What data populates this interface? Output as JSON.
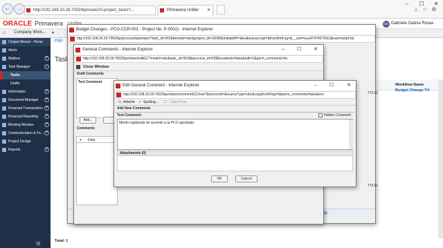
{
  "browser": {
    "url": "http://192.168.20.26:7002/bp/route/2/i-project_tasks?...",
    "tab_title": "Primavera Unifier"
  },
  "oracle": {
    "brand": "ORACLE",
    "product": "Primavera",
    "product_suffix": "Unifier",
    "workspace": "Company Work...",
    "user_initials": "GG",
    "user_name": "Gabriela Galicia Rosas"
  },
  "sidebar": {
    "items": [
      {
        "label": "Chapel-Resort - Home"
      },
      {
        "label": "Alerts"
      },
      {
        "label": "Mailbox"
      },
      {
        "label": "Task Manager"
      },
      {
        "label": "Tasks"
      },
      {
        "label": "Drafts"
      },
      {
        "label": "Information"
      },
      {
        "label": "Document Manager"
      },
      {
        "label": "Financial Transactions"
      },
      {
        "label": "Financial Reporting"
      },
      {
        "label": "Meeting Minutes"
      },
      {
        "label": "Communication & Fo..."
      },
      {
        "label": "Project Design"
      },
      {
        "label": "Reports"
      }
    ]
  },
  "main": {
    "title_partial": "Task",
    "psp": "PSP",
    "workflow_name_header": "Workflow Name",
    "workflow_value": "Budget Change TU",
    "total": "Total: 1",
    "amount1": "773.61",
    "amount2": "773.61",
    "mail_link": "ted Mail (0)"
  },
  "dialog_budget": {
    "title": "Budget Changes - PCO-CCR-001 - Project No. P-0002) - Internet Explorer",
    "url": "http://192.168.20.26:7002/bp/process/task/open?task_id=3018&model=ubc&project_id=10098&initiateBP=&bulkautoaccept=&fromRefLog=&__uref=uuu474745709c3&raw=inelpt:fal"
  },
  "dialog_general": {
    "title": "General Comments - Internet Explorer",
    "url": "http://192.168.20.26:7002/bp/share/editGC?model=ubc&task_id=3018&process_id=528&readonly=false&edit=1&perm_comments=fa",
    "close_window": "Close Window",
    "draft_comments": "Draft Comments",
    "text_comment": "Text Comment",
    "add": "Add...",
    "comments": "Comments",
    "date_col": "Date"
  },
  "dialog_edit": {
    "title": "Edit General Comment - Internet Explorer",
    "url": "http://192.168.20.26:7002/bp/share/commentGC/new?&sourceId=&sourceType=ubc&copyfromFlag=0&perm_comments=false&mo",
    "attach": "Attach",
    "spelling": "Spelling...",
    "copy_from": "Copy From",
    "add_new_comments": "Add New Comments",
    "text_comment": "Text Comment:",
    "hidden_comment": "Hidden Comment",
    "comment_text": "Monto registrado de acuerdo a la PCO aprobada",
    "attachments": "Attachments  (0)",
    "ok": "OK",
    "cancel": "Cancel"
  },
  "colors": {
    "sidebar_bg": "#1e2f47",
    "oracle_red": "#e2231a",
    "accent_blue": "#0b5bb5"
  }
}
